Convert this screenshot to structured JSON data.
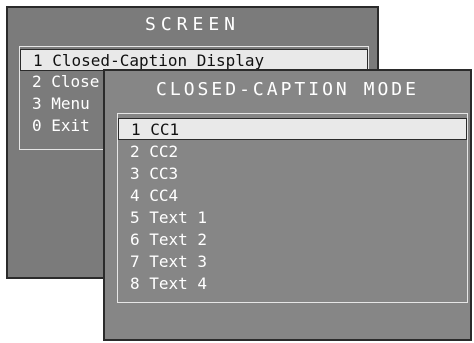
{
  "screen_menu": {
    "title": "SCREEN",
    "items": [
      {
        "label": "1 Closed-Caption Display"
      },
      {
        "label": "2 Close"
      },
      {
        "label": "3 Menu"
      },
      {
        "label": "0 Exit"
      }
    ]
  },
  "cc_menu": {
    "title": "CLOSED-CAPTION MODE",
    "items": [
      {
        "label": "1 CC1"
      },
      {
        "label": "2 CC2"
      },
      {
        "label": "3 CC3"
      },
      {
        "label": "4 CC4"
      },
      {
        "label": "5 Text 1"
      },
      {
        "label": "6 Text 2"
      },
      {
        "label": "7 Text 3"
      },
      {
        "label": "8 Text 4"
      }
    ]
  }
}
